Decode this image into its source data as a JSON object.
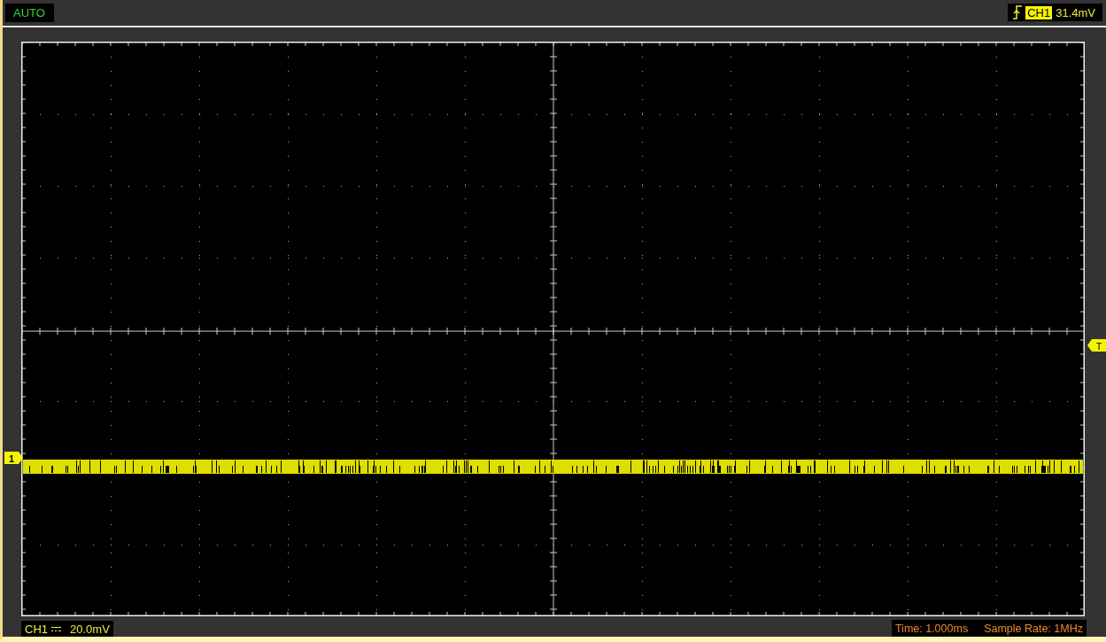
{
  "status": "AUTO",
  "trigger": {
    "channel": "CH1",
    "level": "31.4mV"
  },
  "channel_scale": {
    "channel": "CH1",
    "scale": "20.0mV"
  },
  "timebase": "Time: 1.000ms",
  "sample_rate": "Sample Rate: 1MHz",
  "markers": {
    "channel": "1",
    "trigger": "T"
  }
}
